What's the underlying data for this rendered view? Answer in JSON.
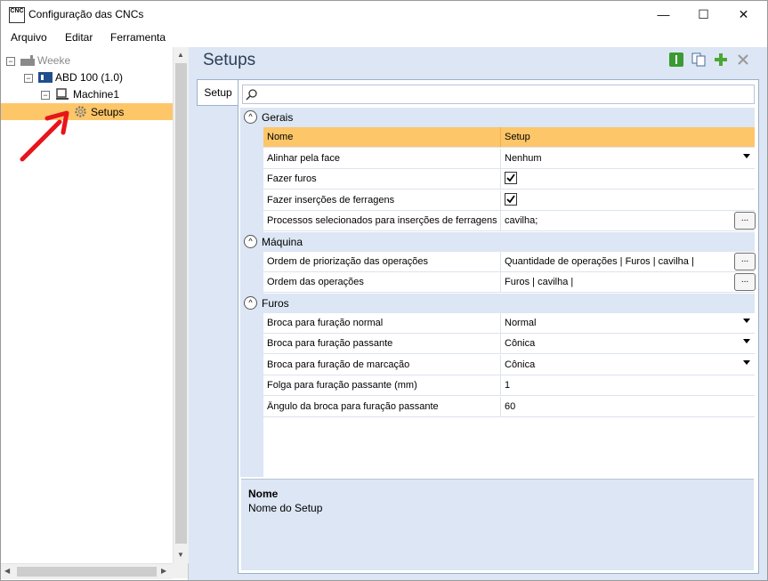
{
  "window": {
    "icon_text": "CNC",
    "title": "Configuração das CNCs",
    "minimize": "—",
    "maximize": "☐",
    "close": "✕"
  },
  "menu": [
    "Arquivo",
    "Editar",
    "Ferramenta"
  ],
  "tree": {
    "root": "Weeke",
    "machine_group": "ABD 100 (1.0)",
    "machine": "Machine1",
    "selected": "Setups"
  },
  "main": {
    "title": "Setups",
    "tab": "Setup",
    "search_placeholder": ""
  },
  "grid": {
    "header": {
      "name": "Nome",
      "value": "Setup"
    },
    "categories": [
      {
        "label": "Gerais",
        "rows": [
          {
            "name": "Alinhar pela face",
            "value": "Nenhum",
            "type": "dropdown"
          },
          {
            "name": "Fazer furos",
            "value": "",
            "checked": true,
            "type": "checkbox"
          },
          {
            "name": "Fazer inserções de ferragens",
            "value": "",
            "checked": true,
            "type": "checkbox"
          },
          {
            "name": "Processos selecionados para inserções de ferragens",
            "value": "cavilha;",
            "type": "ellipsis"
          }
        ]
      },
      {
        "label": "Máquina",
        "rows": [
          {
            "name": "Ordem de priorização das operações",
            "value": "Quantidade de operações | Furos | cavilha |",
            "type": "ellipsis"
          },
          {
            "name": "Ordem das operações",
            "value": "Furos | cavilha |",
            "type": "ellipsis"
          }
        ]
      },
      {
        "label": "Furos",
        "rows": [
          {
            "name": "Broca para furação normal",
            "value": "Normal",
            "type": "dropdown"
          },
          {
            "name": "Broca para furação passante",
            "value": "Cônica",
            "type": "dropdown"
          },
          {
            "name": "Broca para furação de marcação",
            "value": "Cônica",
            "type": "dropdown"
          },
          {
            "name": "Folga para furação passante (mm)",
            "value": "1",
            "type": "text"
          },
          {
            "name": "Ângulo da broca para furação passante",
            "value": "60",
            "type": "text"
          }
        ]
      }
    ]
  },
  "description": {
    "title": "Nome",
    "text": "Nome do Setup"
  },
  "ellipsis_label": "...",
  "colors": {
    "selection": "#fdc668",
    "panel_bg": "#dce6f4",
    "annotation_arrow": "#e8141b"
  }
}
